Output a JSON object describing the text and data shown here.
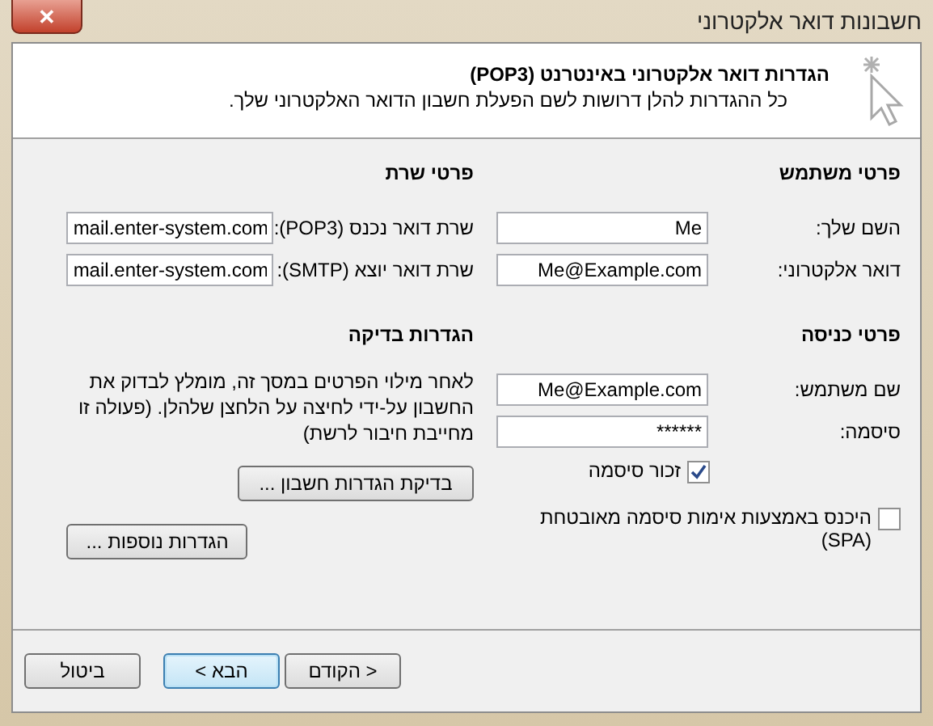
{
  "window": {
    "title": "חשבונות דואר אלקטרוני",
    "close": "✕"
  },
  "header": {
    "title": "הגדרות דואר אלקטרוני באינטרנט (POP3)",
    "subtitle": "כל ההגדרות להלן דרושות לשם הפעלת חשבון הדואר האלקטרוני שלך."
  },
  "user_section": {
    "title": "פרטי משתמש",
    "fields": [
      {
        "label": "השם שלך:",
        "value": "Me"
      },
      {
        "label": "דואר אלקטרוני:",
        "value": "Me@Example.com"
      }
    ]
  },
  "login_section": {
    "title": "פרטי כניסה",
    "fields": [
      {
        "label": "שם משתמש:",
        "value": "Me@Example.com"
      },
      {
        "label": "סיסמה:",
        "value": "******"
      }
    ],
    "checkboxes": [
      {
        "label": "זכור סיסמה",
        "checked": true
      },
      {
        "label": "היכנס באמצעות אימות סיסמה מאובטחת (SPA)",
        "checked": false
      }
    ]
  },
  "server_section": {
    "title": "פרטי שרת",
    "fields": [
      {
        "label": "שרת דואר נכנס (POP3):",
        "value": "mail.enter-system.com"
      },
      {
        "label": "שרת דואר יוצא (SMTP):",
        "value": "mail.enter-system.com"
      }
    ]
  },
  "test_section": {
    "title": "הגדרות בדיקה",
    "text": "לאחר מילוי הפרטים במסך זה, מומלץ לבדוק את החשבון על-ידי לחיצה על הלחצן שלהלן. (פעולה זו מחייבת חיבור לרשת)",
    "button": "בדיקת הגדרות חשבון ..."
  },
  "more_button": "הגדרות נוספות ...",
  "buttons": [
    {
      "label": "< הקודם",
      "selected": false
    },
    {
      "label": "הבא >",
      "selected": true
    },
    {
      "label": "ביטול",
      "selected": false
    }
  ]
}
